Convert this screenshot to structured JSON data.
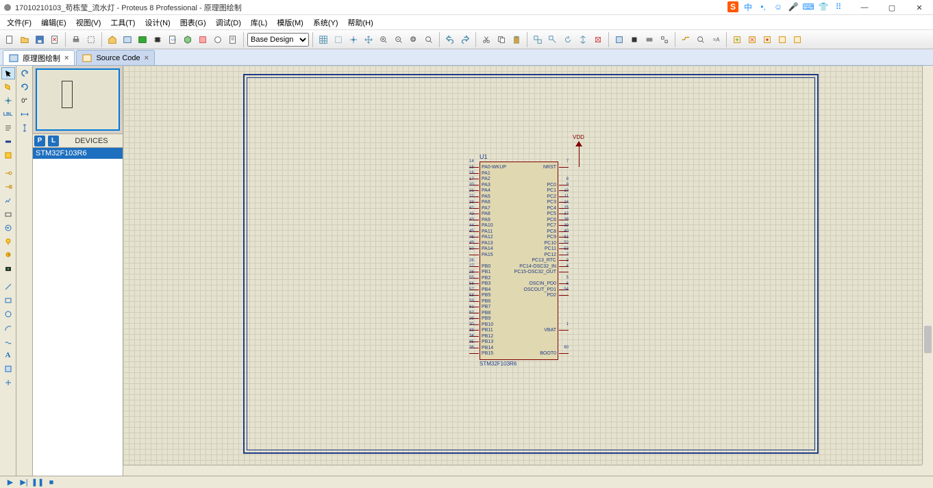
{
  "window": {
    "title": "17010210103_苟栋莹_流水灯 - Proteus 8 Professional - 原理图绘制"
  },
  "ime": {
    "sogou": "S",
    "lang": "中"
  },
  "menu": {
    "file": "文件(F)",
    "edit": "编辑(E)",
    "view": "视图(V)",
    "tool": "工具(T)",
    "design": "设计(N)",
    "chart": "图表(G)",
    "debug": "调试(D)",
    "lib": "库(L)",
    "template": "模版(M)",
    "system": "系统(Y)",
    "help": "帮助(H)"
  },
  "toolbar": {
    "design_dropdown": "Base Design"
  },
  "tabs": {
    "schematic": {
      "label": "原理图绘制"
    },
    "source": {
      "label": "Source Code"
    }
  },
  "panel": {
    "devices_label": "DEVICES",
    "p_btn": "P",
    "l_btn": "L",
    "device_item": "STM32F103R6"
  },
  "rotation": {
    "angle": "0°"
  },
  "component": {
    "ref": "U1",
    "name": "STM32F103R6",
    "vdd": "VDD",
    "left_pins": [
      {
        "num": "14",
        "lbl": "PA0-WKUP"
      },
      {
        "num": "15",
        "lbl": "PA1"
      },
      {
        "num": "16",
        "lbl": "PA2"
      },
      {
        "num": "17",
        "lbl": "PA3"
      },
      {
        "num": "20",
        "lbl": "PA4"
      },
      {
        "num": "21",
        "lbl": "PA5"
      },
      {
        "num": "22",
        "lbl": "PA6"
      },
      {
        "num": "23",
        "lbl": "PA7"
      },
      {
        "num": "41",
        "lbl": "PA8"
      },
      {
        "num": "42",
        "lbl": "PA9"
      },
      {
        "num": "43",
        "lbl": "PA10"
      },
      {
        "num": "44",
        "lbl": "PA11"
      },
      {
        "num": "45",
        "lbl": "PA12"
      },
      {
        "num": "46",
        "lbl": "PA13"
      },
      {
        "num": "49",
        "lbl": "PA14"
      },
      {
        "num": "50",
        "lbl": "PA15"
      },
      {
        "num": "",
        "lbl": ""
      },
      {
        "num": "26",
        "lbl": "PB0"
      },
      {
        "num": "27",
        "lbl": "PB1"
      },
      {
        "num": "28",
        "lbl": "PB2"
      },
      {
        "num": "55",
        "lbl": "PB3"
      },
      {
        "num": "56",
        "lbl": "PB4"
      },
      {
        "num": "57",
        "lbl": "PB5"
      },
      {
        "num": "58",
        "lbl": "PB6"
      },
      {
        "num": "59",
        "lbl": "PB7"
      },
      {
        "num": "61",
        "lbl": "PB8"
      },
      {
        "num": "62",
        "lbl": "PB9"
      },
      {
        "num": "29",
        "lbl": "PB10"
      },
      {
        "num": "30",
        "lbl": "PB11"
      },
      {
        "num": "33",
        "lbl": "PB12"
      },
      {
        "num": "34",
        "lbl": "PB13"
      },
      {
        "num": "35",
        "lbl": "PB14"
      },
      {
        "num": "36",
        "lbl": "PB15"
      }
    ],
    "right_pins": [
      {
        "num": "7",
        "lbl": "NRST"
      },
      {
        "num": "",
        "lbl": ""
      },
      {
        "num": "",
        "lbl": ""
      },
      {
        "num": "8",
        "lbl": "PC0"
      },
      {
        "num": "9",
        "lbl": "PC1"
      },
      {
        "num": "10",
        "lbl": "PC2"
      },
      {
        "num": "11",
        "lbl": "PC3"
      },
      {
        "num": "24",
        "lbl": "PC4"
      },
      {
        "num": "25",
        "lbl": "PC5"
      },
      {
        "num": "37",
        "lbl": "PC6"
      },
      {
        "num": "38",
        "lbl": "PC7"
      },
      {
        "num": "39",
        "lbl": "PC8"
      },
      {
        "num": "40",
        "lbl": "PC9"
      },
      {
        "num": "51",
        "lbl": "PC10"
      },
      {
        "num": "52",
        "lbl": "PC11"
      },
      {
        "num": "53",
        "lbl": "PC12"
      },
      {
        "num": "2",
        "lbl": "PC13_RTC"
      },
      {
        "num": "3",
        "lbl": "PC14-OSC32_IN"
      },
      {
        "num": "4",
        "lbl": "PC15-OSC32_OUT"
      },
      {
        "num": "",
        "lbl": ""
      },
      {
        "num": "5",
        "lbl": "OSCIN_PD0"
      },
      {
        "num": "6",
        "lbl": "OSCOUT_PD1"
      },
      {
        "num": "54",
        "lbl": "PD2"
      },
      {
        "num": "",
        "lbl": ""
      },
      {
        "num": "",
        "lbl": ""
      },
      {
        "num": "",
        "lbl": ""
      },
      {
        "num": "",
        "lbl": ""
      },
      {
        "num": "",
        "lbl": ""
      },
      {
        "num": "1",
        "lbl": "VBAT"
      },
      {
        "num": "",
        "lbl": ""
      },
      {
        "num": "",
        "lbl": ""
      },
      {
        "num": "",
        "lbl": ""
      },
      {
        "num": "60",
        "lbl": "BOOT0"
      }
    ]
  }
}
